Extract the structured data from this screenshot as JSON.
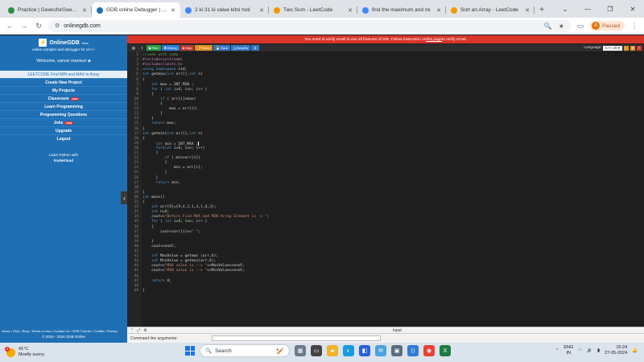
{
  "browser": {
    "tabs": [
      {
        "title": "Practice | GeeksforGeeks |",
        "color": "#2f8d46",
        "active": false
      },
      {
        "title": "GDB online Debugger | Co",
        "color": "#1f6fb4",
        "active": true
      },
      {
        "title": "2 ki 31 ki value kitni hoti",
        "color": "#4285f4",
        "active": false
      },
      {
        "title": "Two Sum - LeetCode",
        "color": "#f29900",
        "active": false
      },
      {
        "title": "find the maximum and mi",
        "color": "#4285f4",
        "active": false
      },
      {
        "title": "Sort an Array - LeetCode",
        "color": "#f29900",
        "active": false
      }
    ],
    "new_tab": "+",
    "url": "onlinegdb.com",
    "profile_initial": "A",
    "profile_label": "Paused"
  },
  "sidebar": {
    "brand": "OnlineGDB",
    "brand_sup": "beta",
    "tagline": "online compiler and debugger for c/c++",
    "welcome": "Welcome, sarvar mansuri ♣",
    "selected_item": "LEETCODE Find MIN and MAX in Array",
    "items": [
      {
        "label": "Create New Project",
        "badge": ""
      },
      {
        "label": "My Projects",
        "badge": ""
      },
      {
        "label": "Classroom",
        "badge": "new"
      },
      {
        "label": "Learn Programming",
        "badge": ""
      },
      {
        "label": "Programming Questions",
        "badge": ""
      },
      {
        "label": "Jobs",
        "badge": "new"
      },
      {
        "label": "Upgrade",
        "badge": ""
      },
      {
        "label": "Logout",
        "badge": ""
      }
    ],
    "learn_line1": "Learn Python with",
    "learn_line2": "KodeKloud",
    "footer_links": "About • FAQ • Blog • Terms of Use • Contact Us • GDB Tutorial • Credits • Privacy",
    "copyright": "© 2016 - 2024 GDB Online"
  },
  "notice": {
    "before": "You need to verify email to use all features of IDE. Follow instruction on ",
    "link": "this page",
    "after": " to verify email."
  },
  "toolbar": {
    "run": "Run",
    "debug": "Debug",
    "stop": "Stop",
    "share": "Share",
    "save": "Save",
    "beautify": "{} Beautify",
    "language_label": "Language",
    "language_value": "C++ 20"
  },
  "code_lines": [
    "//code with samu",
    "#include<iostream>",
    "#include<limits.h>",
    "using namespace std;",
    "int getmax(int arr[],int n)",
    "{",
    "    int max = INT_MIN ;",
    "    for ( int i=0; i<n; i++ )",
    "    {",
    "        if ( arr[i]>max)",
    "        {",
    "            max = arr[i];",
    "        }",
    "    }",
    "    return max;",
    "}",
    "int getmin(int arr[],int n)",
    "{",
    "      int min = INT_MAX ;",
    "      for(int i=0; i<n; i++)",
    "      {",
    "          if ( min>arr[i])",
    "          {",
    "              min = arr[i];",
    "          }",
    "      }",
    "      return min;",
    "",
    "}",
    "int main()",
    "{",
    "    int arr[8]={9,4,2,1,3,1,6,3};",
    "    int n=8;",
    "    cout<<\"Before Find MAX and MIN Array Element is :> \";",
    "    for ( int i=0; i<n; i++ )",
    "    {",
    "        cout<<arr[i]<<\" \";",
    "",
    "    }",
    "    cout<<endl;",
    "",
    "    int MaxValue = getmax (arr,8);",
    "    int MinValue = getmin(arr,8);",
    "    cout<<\"MAX value is :-> \"<<MaxValue<<endl;",
    "    cout<<\"MIN value is :-> \"<<MinValue<<endl;",
    "",
    "    return 0;",
    "",
    "}"
  ],
  "io": {
    "input_label": "input",
    "cmd_label": "Command line arguments:"
  },
  "taskbar": {
    "temp": "41°C",
    "condition": "Mostly sunny",
    "search_placeholder": "Search",
    "lang_top": "ENG",
    "lang_bottom": "IN",
    "time": "15:24",
    "date": "27-05-2024"
  }
}
